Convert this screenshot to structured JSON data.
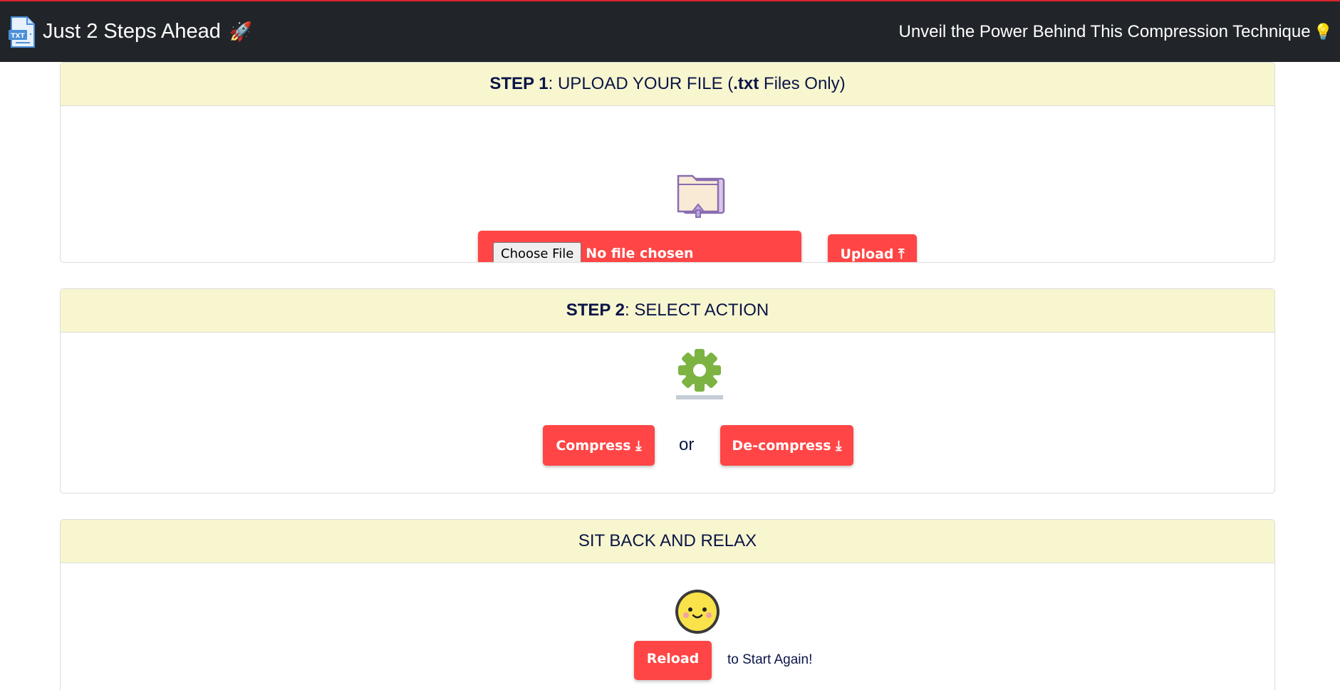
{
  "navbar": {
    "brand_title": "Just 2 Steps Ahead",
    "brand_emoji": "🚀",
    "link_text": "Unveil the Power Behind This Compression Technique",
    "link_emoji": "💡",
    "logo_text": "TXT"
  },
  "step1": {
    "header_bold": "STEP 1",
    "header_mid": ": UPLOAD YOUR FILE (",
    "header_ext": ".txt",
    "header_tail": " Files Only)",
    "choose_label": "Choose File",
    "file_status": "No file chosen",
    "upload_label": "Upload ⤒"
  },
  "step2": {
    "header_bold": "STEP 2",
    "header_tail": ": SELECT ACTION",
    "compress_label": "Compress ⤓",
    "or_text": "or",
    "decompress_label": "De-compress ⤓"
  },
  "step3": {
    "header": "SIT BACK AND RELAX",
    "reload_label": "Reload",
    "hint": "to Start Again!"
  },
  "colors": {
    "navbar_bg": "#212529",
    "accent_red": "#ff4545",
    "header_bg": "#f8f6cf",
    "text_navy": "#0a1547"
  },
  "icons": [
    "txt-file-icon",
    "rocket-icon",
    "lightbulb-icon",
    "folder-upload-icon",
    "gear-icon",
    "smiley-icon"
  ]
}
